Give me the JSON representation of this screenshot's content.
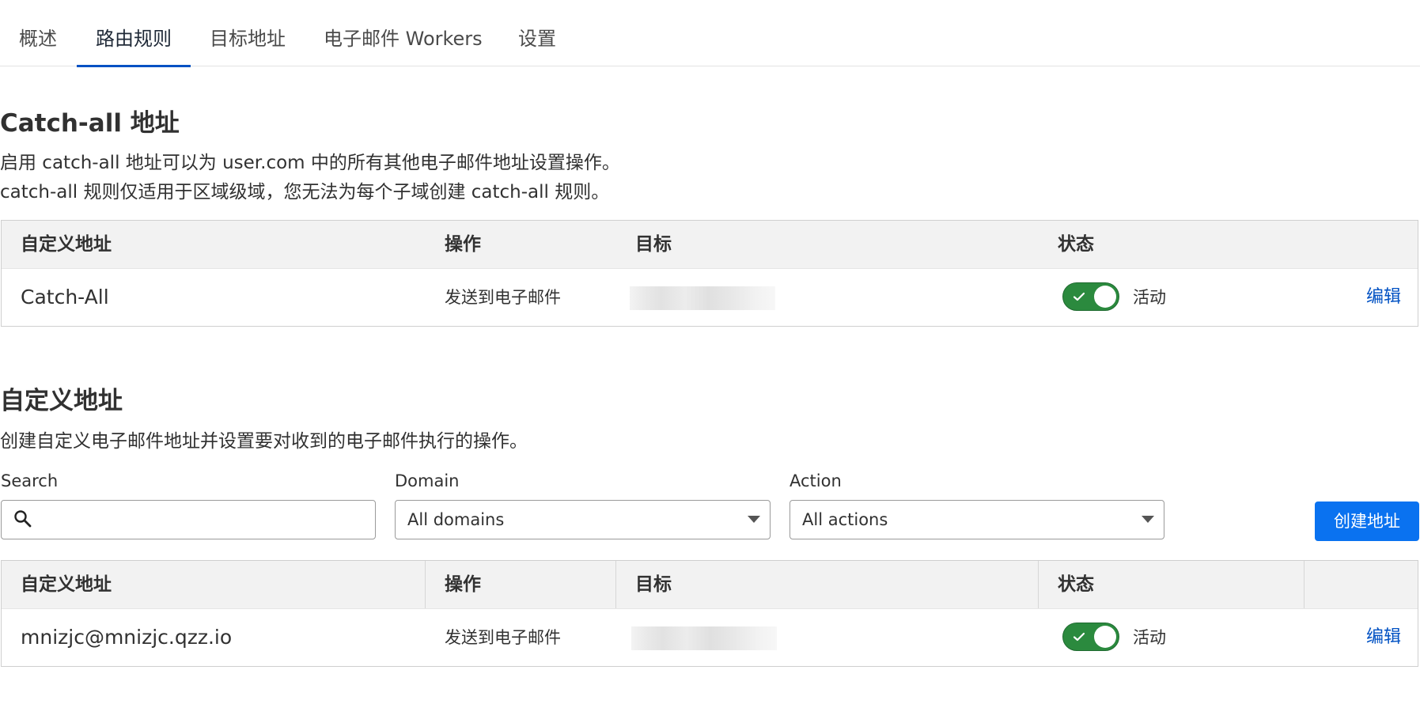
{
  "tabs": [
    {
      "label": "概述"
    },
    {
      "label": "路由规则"
    },
    {
      "label": "目标地址"
    },
    {
      "label": "电子邮件 Workers"
    },
    {
      "label": "设置"
    }
  ],
  "catchall": {
    "title": "Catch-all 地址",
    "desc_line1": "启用 catch-all 地址可以为 user.com 中的所有其他电子邮件地址设置操作。",
    "desc_line2": "catch-all 规则仅适用于区域级域，您无法为每个子域创建 catch-all 规则。",
    "headers": {
      "address": "自定义地址",
      "action": "操作",
      "target": "目标",
      "status": "状态"
    },
    "row": {
      "address": "Catch-All",
      "action": "发送到电子邮件",
      "status": "活动",
      "edit": "编辑"
    }
  },
  "custom": {
    "title": "自定义地址",
    "desc": "创建自定义电子邮件地址并设置要对收到的电子邮件执行的操作。",
    "filters": {
      "search_label": "Search",
      "search_value": "",
      "domain_label": "Domain",
      "domain_value": "All domains",
      "action_label": "Action",
      "action_value": "All actions"
    },
    "create_label": "创建地址",
    "headers": {
      "address": "自定义地址",
      "action": "操作",
      "target": "目标",
      "status": "状态"
    },
    "row": {
      "address": "mnizjc@mnizjc.qzz.io",
      "action": "发送到电子邮件",
      "status": "活动",
      "edit": "编辑"
    }
  },
  "colors": {
    "accent": "#0051c3",
    "primary_button": "#0a72f0",
    "toggle_on": "#2b8a3e"
  },
  "icons": {
    "search": "search-icon",
    "toggle_check": "check-icon",
    "dropdown": "chevron-down-icon"
  }
}
